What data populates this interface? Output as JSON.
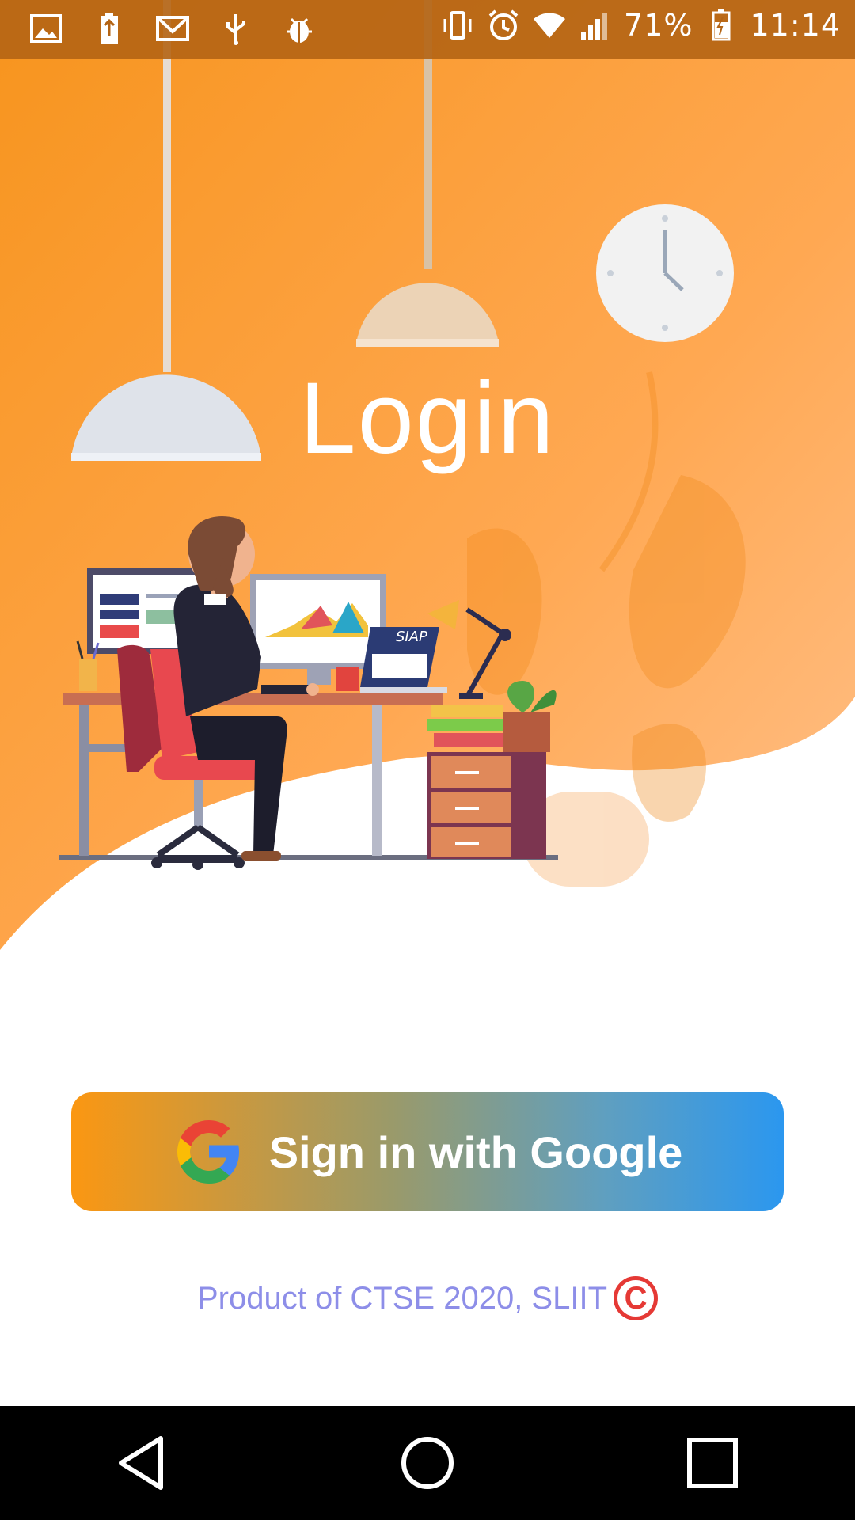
{
  "status_bar": {
    "left_icons": [
      "image-icon",
      "battery-usb-icon",
      "gmail-icon",
      "usb-icon",
      "debug-bug-icon"
    ],
    "battery_percent": "71%",
    "time": "11:14"
  },
  "hero": {
    "title": "Login",
    "illustration": "office-desk-illustration",
    "monitor_badge": "SIAP"
  },
  "signin_button": {
    "label": "Sign in with Google",
    "icon": "google-g-icon"
  },
  "footer": {
    "text": "Product of CTSE 2020, SLIIT",
    "symbol": "C"
  },
  "nav": {
    "back": "back-icon",
    "home": "home-icon",
    "recents": "recents-icon"
  },
  "colors": {
    "orange": "#fb9712",
    "blue": "#2b97ef",
    "footer_text": "#8d8ee8",
    "copyright_red": "#e53935"
  }
}
